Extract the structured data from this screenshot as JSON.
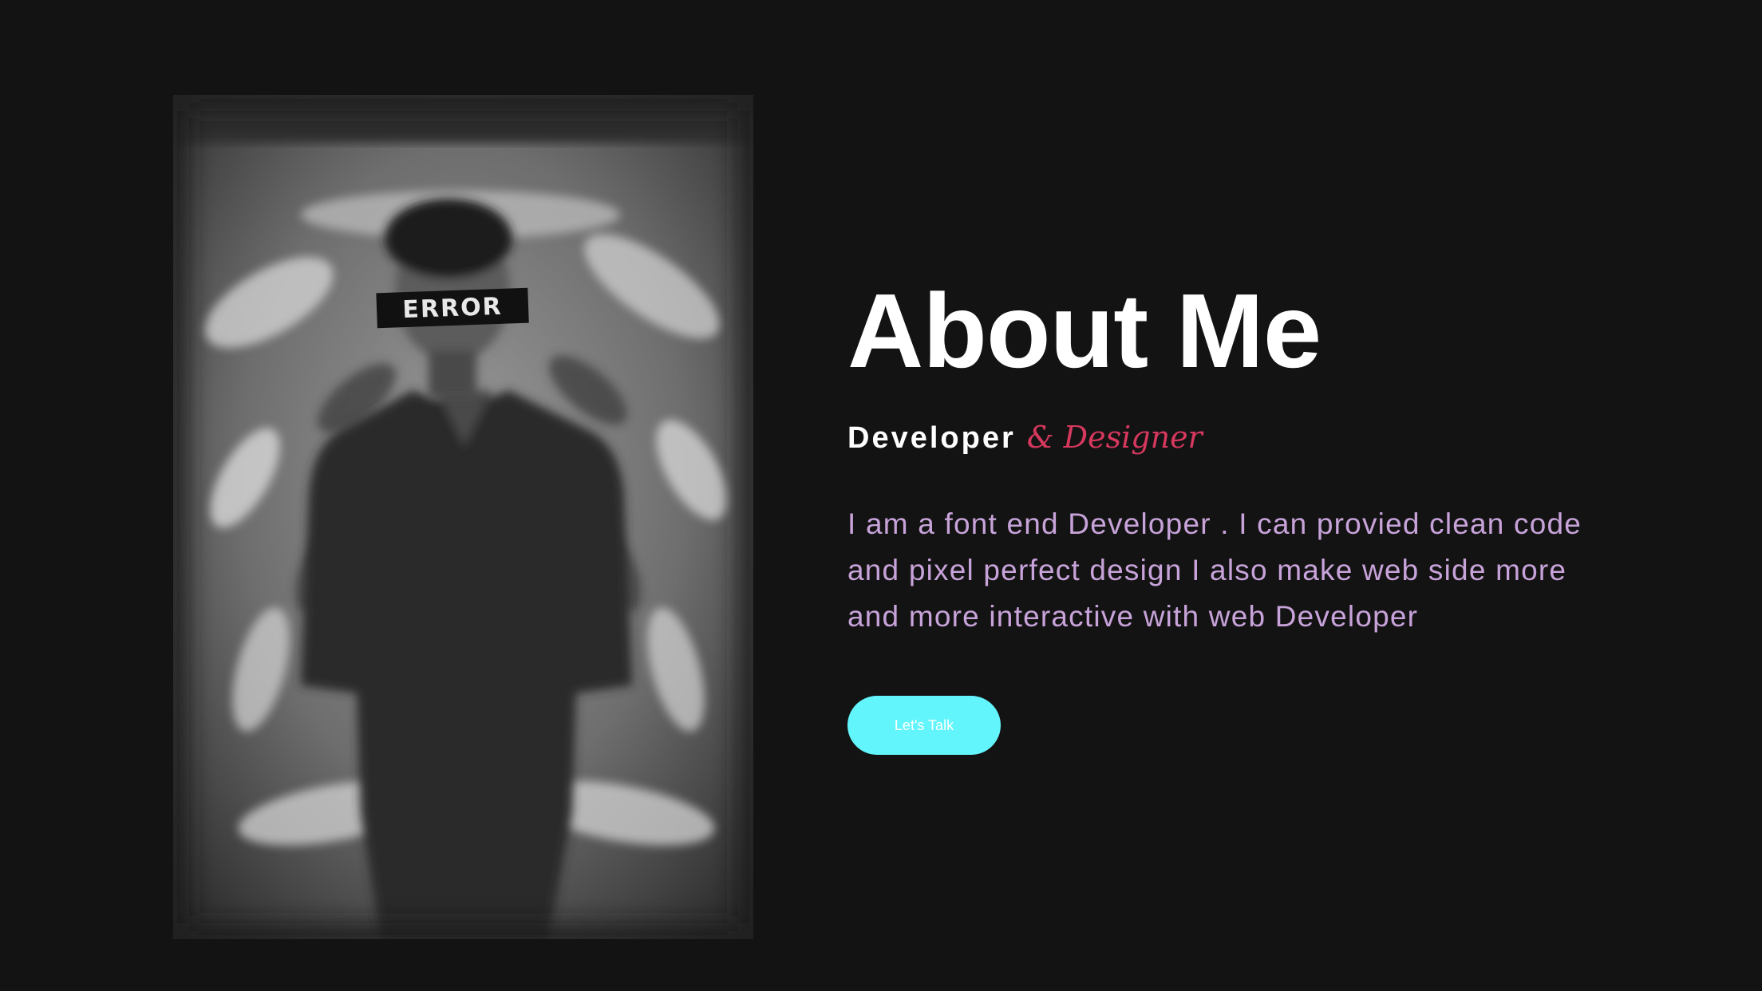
{
  "about": {
    "title": "About Me",
    "subtitle_role": "Developer",
    "subtitle_accent": "& Designer",
    "bio": "I am a font end Developer . I can provied clean code and pixel perfect design I also make web side more and more interactive with web Developer",
    "cta_label": "Let's Talk"
  },
  "photo": {
    "overlay_text": "ERROR",
    "alt": "portrait"
  },
  "colors": {
    "background": "#141314",
    "title": "#ffffff",
    "accent": "#d6385e",
    "bio": "#c7a3d9",
    "button": "#62f5fb"
  }
}
